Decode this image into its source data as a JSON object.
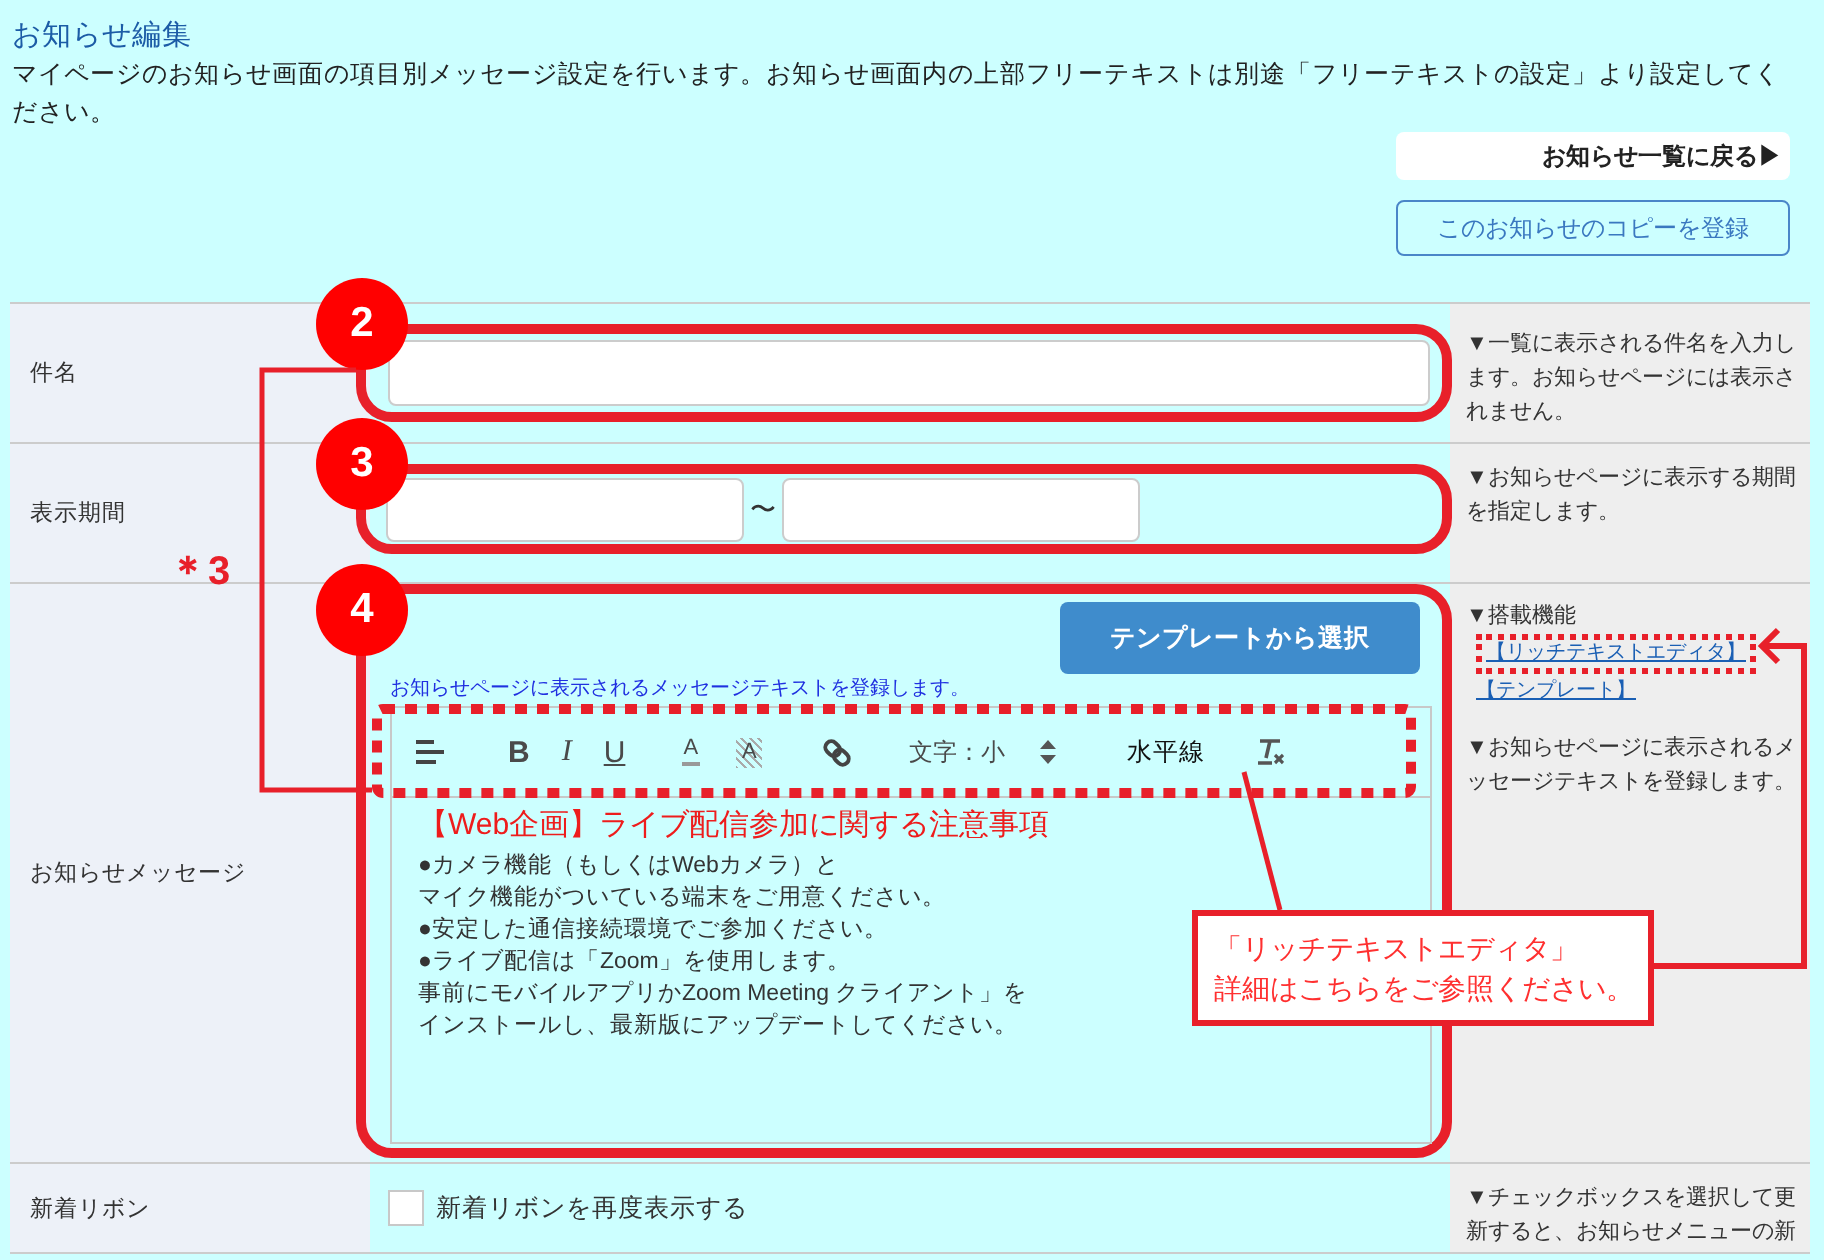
{
  "page": {
    "title": "お知らせ編集",
    "description": "マイページのお知らせ画面の項目別メッセージ設定を行います。お知らせ画面内の上部フリーテキストは別途「フリーテキストの設定」より設定してください。"
  },
  "buttons": [
    {
      "kind": "back",
      "label": "お知らせ一覧に戻る▶"
    },
    {
      "kind": "copy",
      "label": "このお知らせのコピーを登録"
    }
  ],
  "form_rows": [
    {
      "kind": "text",
      "label": "件名",
      "marker": "2",
      "help": [
        {
          "kind": "text",
          "text": "▼一覧に表示される件名を入力します。お知らせページには表示されません。"
        }
      ]
    },
    {
      "kind": "period",
      "label": "表示期間",
      "marker": "3",
      "separator": "〜",
      "help": [
        {
          "kind": "text",
          "text": "▼お知らせページに表示する期間を指定します。"
        }
      ]
    },
    {
      "kind": "editor",
      "label": "お知らせメッセージ",
      "marker": "4",
      "editor": {
        "template_button": "テンプレートから選択",
        "hint": "お知らせページに表示されるメッセージテキストを登録します。",
        "toolbar": {
          "highlighted": true,
          "items": [
            {
              "kind": "align"
            },
            {
              "kind": "bold",
              "label": "B"
            },
            {
              "kind": "italic",
              "label": "I"
            },
            {
              "kind": "underline",
              "label": "U"
            },
            {
              "kind": "font_color",
              "label": "A"
            },
            {
              "kind": "highlight_color",
              "label": "A"
            },
            {
              "kind": "link"
            },
            {
              "kind": "size",
              "label": "文字：小"
            },
            {
              "kind": "rule",
              "label": "水平線"
            },
            {
              "kind": "clear"
            }
          ]
        },
        "heading": "【Web企画】ライブ配信参加に関する注意事項",
        "lines": [
          "●カメラ機能（もしくはWebカメラ）と",
          "マイク機能がついている端末をご用意ください。",
          "●安定した通信接続環境でご参加ください。",
          "●ライブ配信は「Zoom」を使用します。",
          "事前にモバイルアプリかZoom Meeting クライアント」を",
          "インストールし、最新版にアップデートしてください。"
        ]
      },
      "help": [
        {
          "kind": "heading",
          "text": "▼搭載機能"
        },
        {
          "kind": "link",
          "text": "【リッチテキストエディタ】",
          "highlighted": true
        },
        {
          "kind": "link",
          "text": "【テンプレート】",
          "highlighted": false
        },
        {
          "kind": "text",
          "text": "▼お知らせページに表示されるメッセージテキストを登録します。"
        }
      ]
    },
    {
      "kind": "checkbox",
      "label": "新着リボン",
      "checkbox_label": "新着リボンを再度表示する",
      "checked": false,
      "help": [
        {
          "kind": "text",
          "text": "▼チェックボックスを選択して更新すると、お知らせメニューの新"
        }
      ]
    }
  ],
  "annotations": {
    "note": "＊3",
    "callout": [
      "「リッチテキストエディタ」",
      "詳細はこちらをご参照ください。"
    ]
  }
}
